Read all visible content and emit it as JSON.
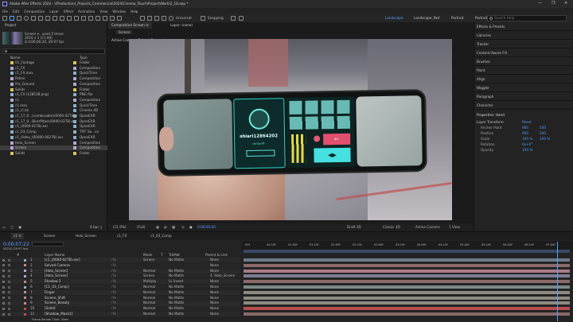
{
  "app": {
    "title": "Adobe After Effects 2024 - \\(Production)_Projects_Commercial\\2024\\Cinema_Touch\\Project\\Work\\2_18.aep *",
    "window_controls": [
      "—",
      "❐",
      "✕"
    ]
  },
  "menu": [
    "File",
    "Edit",
    "Composition",
    "Layer",
    "Effect",
    "Animation",
    "View",
    "Window",
    "Help"
  ],
  "toolbar": {
    "universal": "Universal",
    "snapping": "Snapping",
    "workspaces": [
      "Landscape",
      "Landscape_Pad",
      "Portrait",
      "Portrait_Pad"
    ],
    "active_workspace": "Landscape",
    "help_placeholder": "Search Help"
  },
  "project": {
    "tab": "Project",
    "comp_info": [
      "Screen ▾ , used 2 times",
      "2016 x 1 (F1.00)",
      "Δ 0;00;00;20, 29.97 fps"
    ],
    "search_placeholder": "",
    "col_name": "Name",
    "col_type": "Type",
    "items": [
      {
        "name": "01_Footage",
        "type": "Folder",
        "color": "#d8c45a",
        "sel": false
      },
      {
        "name": "c1_FX",
        "type": "Composition",
        "color": "#b5a6d6",
        "sel": false
      },
      {
        "name": "c1_FX.mov",
        "type": "QuickTime",
        "color": "#8ab0c6",
        "sel": false
      },
      {
        "name": "Pollen",
        "type": "Composition",
        "color": "#b5a6d6",
        "sel": false
      },
      {
        "name": "Pre_Ground",
        "type": "Composition",
        "color": "#b5a6d6",
        "sel": false
      },
      {
        "name": "Solids",
        "type": "Folder",
        "color": "#d8c45a",
        "sel": false
      },
      {
        "name": "c1_FX (138538.png)",
        "type": "PNG file",
        "color": "#8ab0c6",
        "sel": false
      },
      {
        "name": "c1",
        "type": "Composition",
        "color": "#b5a6d6",
        "sel": false
      },
      {
        "name": "c1.mov",
        "type": "QuickTime",
        "color": "#8ab0c6",
        "sel": false
      },
      {
        "name": "c1_cl.nk",
        "type": "Cinema 4D",
        "color": "#8ab0c6",
        "sel": false
      },
      {
        "name": "c1_17_0...(combinable)(0000-0278).exr",
        "type": "OpenEXR",
        "color": "#8ab0c6",
        "sel": false
      },
      {
        "name": "c1_17_0...Blurrfiltaer(0000-0278).exr",
        "type": "OpenEXR",
        "color": "#8ab0c6",
        "sel": false
      },
      {
        "name": "c1_(0000-0278).exr",
        "type": "OpenEXR",
        "color": "#8ab0c6",
        "sel": false
      },
      {
        "name": "c1_03_Comp",
        "type": "TIFF Se...ce",
        "color": "#8ab0c6",
        "sel": false
      },
      {
        "name": "c1_Video_(00000-00278).exr",
        "type": "OpenEXR",
        "color": "#8ab0c6",
        "sel": false
      },
      {
        "name": "Holo_Screen",
        "type": "Composition",
        "color": "#b5a6d6",
        "sel": false
      },
      {
        "name": "Screen",
        "type": "Composition",
        "color": "#b5a6d6",
        "sel": true
      },
      {
        "name": "Solids",
        "type": "Folder",
        "color": "#d8c45a",
        "sel": false
      }
    ],
    "footer_bpc": "8 bpc"
  },
  "viewer": {
    "tabs": [
      "Composition Screen ≡",
      "Layer: (none)"
    ],
    "breadcrumb": "Screen",
    "camera_label": "Active Camera (Solved Camera)",
    "bottom": {
      "zoom": "(11.9%)",
      "quality": "(Full)",
      "timecode": "0;00;05;00",
      "renderer": "Classic 3D",
      "camera": "Active Camera",
      "views": "1 View",
      "draft": "Draft 3D"
    }
  },
  "phone_ui": {
    "contact_name": "shiari12864202",
    "contact_sub": "contact4",
    "key_symbols": [
      "←",
      "◀▶"
    ]
  },
  "right_panel": {
    "sections": [
      "Effects & Presets",
      "Libraries",
      "Tracker",
      "Content-Aware Fill",
      "Brushes",
      "Paint",
      "Align",
      "Wiggler",
      "Paragraph",
      "Character"
    ],
    "properties_title": "Properties: Hand",
    "layer_transform": "Layer Transform",
    "reset": "Reset",
    "props": [
      {
        "label": "Anchor Point",
        "v1": "960",
        "v2": "540"
      },
      {
        "label": "Position",
        "v1": "960",
        "v2": "540"
      },
      {
        "label": "Scale",
        "v1": "100 %",
        "v2": "100 %"
      },
      {
        "label": "Rotation",
        "v1": "0x+0°",
        "v2": ""
      },
      {
        "label": "Opacity",
        "v1": "100 %",
        "v2": ""
      }
    ]
  },
  "timeline": {
    "tabs": [
      "c1 ≡",
      "Screen",
      "Holo_Screen",
      "c1_FX",
      "c1_03_Comp"
    ],
    "timecode": "0;00;07;22",
    "fps_info": "00232 (29.97 fps)",
    "col_headers": [
      "#",
      "Layer Name",
      "Mode",
      "T",
      "TrkMat",
      "Parent & Link"
    ],
    "ruler": [
      "00f",
      "00:15f",
      "01:00f",
      "01:15f",
      "02:00f",
      "02:15f",
      "03:00f",
      "03:15f",
      "04:00f",
      "04:15f",
      "05:00f",
      "05:15f",
      "06:00f",
      "06:15f",
      "07:00f"
    ],
    "layers": [
      {
        "num": "1",
        "name": "[c1_(0000-0278).exr]",
        "mode": "Screen",
        "trk": "No Matte",
        "parent": "None",
        "color": "#8ab0c6",
        "bar": "#6d7a8a"
      },
      {
        "num": "2",
        "name": "Solved Camera",
        "mode": "",
        "trk": "",
        "parent": "None",
        "color": "#c48a8a",
        "bar": "#8a6a6a"
      },
      {
        "num": "3",
        "name": "[Holo_Screen]",
        "mode": "Normal",
        "trk": "No Matte",
        "parent": "None",
        "color": "#b5a6d6",
        "bar": "#a77a86"
      },
      {
        "num": "4",
        "name": "[Holo_Screen]",
        "mode": "Screen",
        "trk": "No Matte",
        "parent": "4. Holo_Screen",
        "color": "#b5a6d6",
        "bar": "#7e7c92"
      },
      {
        "num": "5",
        "name": "Shadow 2",
        "mode": "Multiply",
        "trk": "LL Invert",
        "parent": "None",
        "color": "#c48a8a",
        "bar": "#8a6a6a"
      },
      {
        "num": "6",
        "name": "[C1_03_Comp]",
        "mode": "Normal",
        "trk": "No Matte",
        "parent": "None",
        "color": "#8ab0c6",
        "bar": "#7b8a86"
      },
      {
        "num": "7",
        "name": "Finger",
        "mode": "Normal",
        "trk": "No Matte",
        "parent": "None",
        "color": "#c48a8a",
        "bar": "#8c8a82"
      },
      {
        "num": "8",
        "name": "Screen_Shift",
        "mode": "Normal",
        "trk": "No Matte",
        "parent": "None",
        "color": "#c48a8a",
        "bar": "#8c8a82"
      },
      {
        "num": "9",
        "name": "Screen_Beauty",
        "mode": "Normal",
        "trk": "No Matte",
        "parent": "None",
        "color": "#c48a8a",
        "bar": "#8c8a82"
      },
      {
        "num": "10",
        "name": "[Solid]",
        "mode": "Normal",
        "trk": "No Matte",
        "parent": "None",
        "color": "#c44a4a",
        "bar": "#b74d4d"
      },
      {
        "num": "11",
        "name": "[Shadow_Mask1]",
        "mode": "Normal",
        "trk": "No Matte",
        "parent": "None",
        "color": "#c44a4a",
        "bar": "#8a6a6a"
      }
    ],
    "footer": "Frame Render Time: 34ms"
  }
}
